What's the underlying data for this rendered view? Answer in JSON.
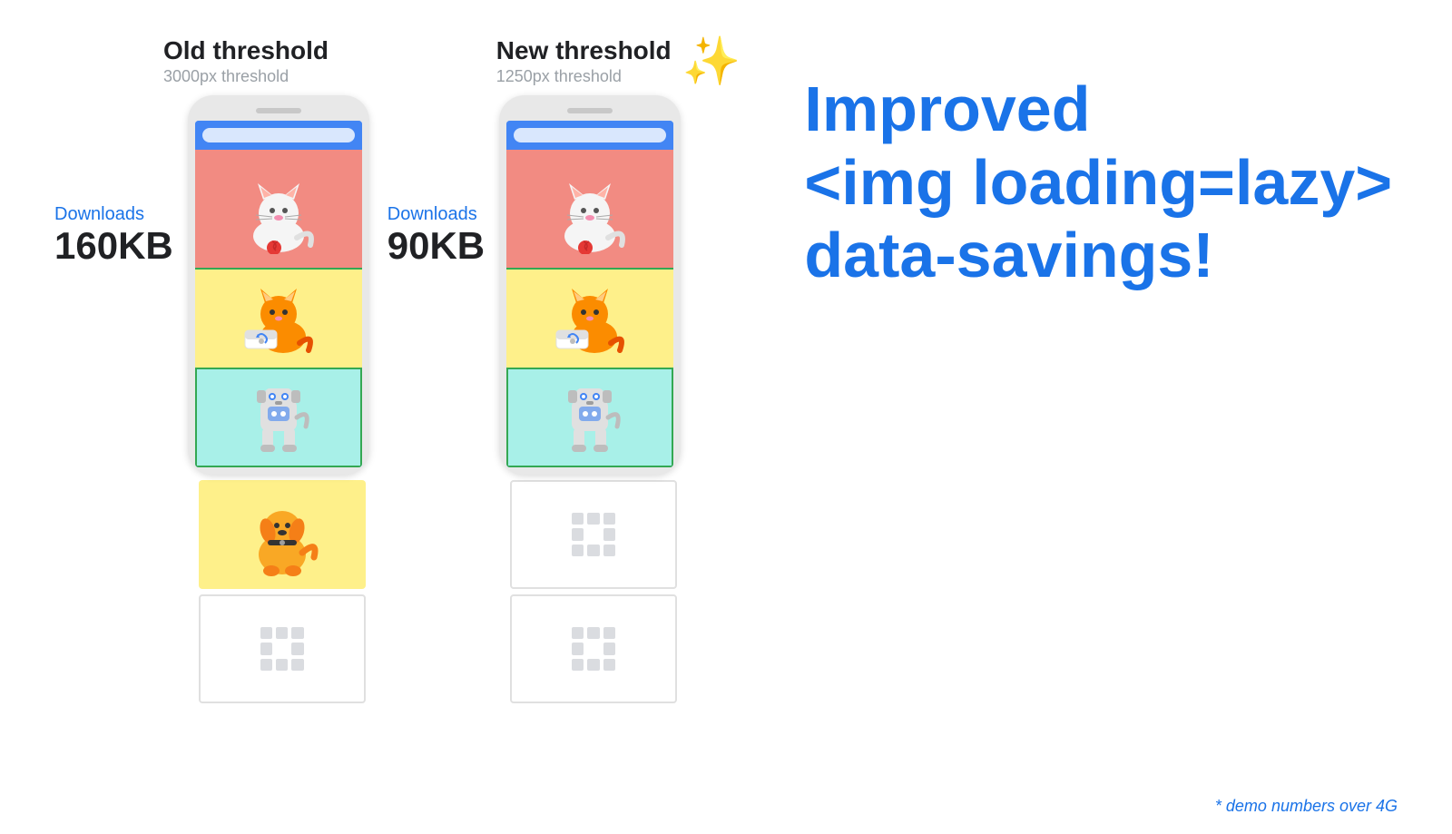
{
  "old_threshold": {
    "title": "Old threshold",
    "subtitle": "3000px threshold",
    "downloads_label": "Downloads",
    "downloads_size": "160KB"
  },
  "new_threshold": {
    "title": "New threshold",
    "subtitle": "1250px threshold",
    "downloads_label": "Downloads",
    "downloads_size": "90KB"
  },
  "headline_line1": "Improved",
  "headline_line2": "<img loading=lazy>",
  "headline_line3": "data-savings!",
  "demo_note": "* demo numbers over 4G"
}
